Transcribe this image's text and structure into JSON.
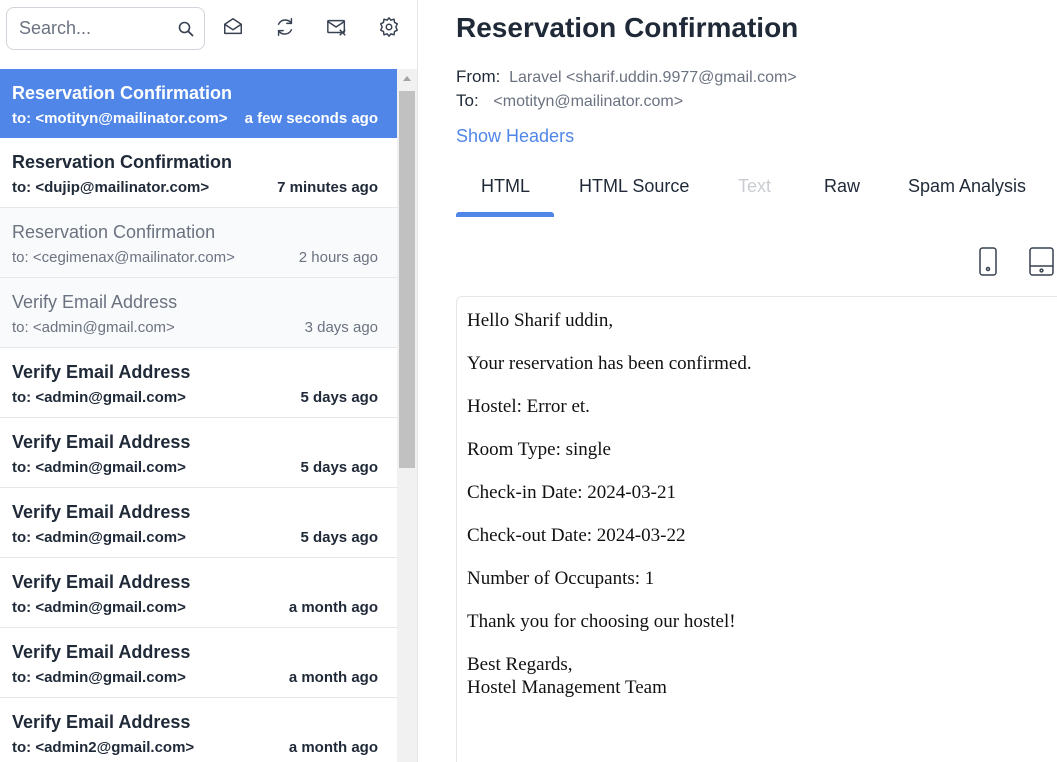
{
  "search": {
    "placeholder": "Search..."
  },
  "toolbar": {
    "icons": [
      "envelope-open-icon",
      "refresh-icon",
      "mark-read-icon",
      "settings-gear-icon"
    ]
  },
  "emails": [
    {
      "subject": "Reservation Confirmation",
      "to": "to: <motityn@mailinator.com>",
      "time": "a few seconds ago",
      "state": "selected"
    },
    {
      "subject": "Reservation Confirmation",
      "to": "to: <dujip@mailinator.com>",
      "time": "7 minutes ago",
      "state": "unread"
    },
    {
      "subject": "Reservation Confirmation",
      "to": "to: <cegimenax@mailinator.com>",
      "time": "2 hours ago",
      "state": "read"
    },
    {
      "subject": "Verify Email Address",
      "to": "to: <admin@gmail.com>",
      "time": "3 days ago",
      "state": "read"
    },
    {
      "subject": "Verify Email Address",
      "to": "to: <admin@gmail.com>",
      "time": "5 days ago",
      "state": "unread"
    },
    {
      "subject": "Verify Email Address",
      "to": "to: <admin@gmail.com>",
      "time": "5 days ago",
      "state": "unread"
    },
    {
      "subject": "Verify Email Address",
      "to": "to: <admin@gmail.com>",
      "time": "5 days ago",
      "state": "unread"
    },
    {
      "subject": "Verify Email Address",
      "to": "to: <admin@gmail.com>",
      "time": "a month ago",
      "state": "unread"
    },
    {
      "subject": "Verify Email Address",
      "to": "to: <admin@gmail.com>",
      "time": "a month ago",
      "state": "unread"
    },
    {
      "subject": "Verify Email Address",
      "to": "to: <admin2@gmail.com>",
      "time": "a month ago",
      "state": "unread"
    }
  ],
  "message": {
    "title": "Reservation Confirmation",
    "from_label": "From:",
    "from_value": "Laravel <sharif.uddin.9977@gmail.com>",
    "to_label": "To:",
    "to_value": "<motityn@mailinator.com>",
    "show_headers": "Show Headers"
  },
  "tabs": [
    {
      "label": "HTML",
      "state": "active"
    },
    {
      "label": "HTML Source",
      "state": "normal"
    },
    {
      "label": "Text",
      "state": "disabled"
    },
    {
      "label": "Raw",
      "state": "normal"
    },
    {
      "label": "Spam Analysis",
      "state": "normal"
    }
  ],
  "devices": [
    "mobile-view-icon",
    "tablet-view-icon"
  ],
  "body": {
    "greeting": "Hello Sharif uddin,",
    "line1": "Your reservation has been confirmed.",
    "hostel": "Hostel: Error et.",
    "room_type": "Room Type: single",
    "check_in": "Check-in Date: 2024-03-21",
    "check_out": "Check-out Date: 2024-03-22",
    "occupants": "Number of Occupants: 1",
    "thanks": "Thank you for choosing our hostel!",
    "regards": "Best Regards,",
    "team": "Hostel Management Team"
  },
  "colors": {
    "accent": "#4f86e8",
    "text": "#1f2937",
    "muted": "#6b7280",
    "disabled": "#c9ccd1"
  }
}
